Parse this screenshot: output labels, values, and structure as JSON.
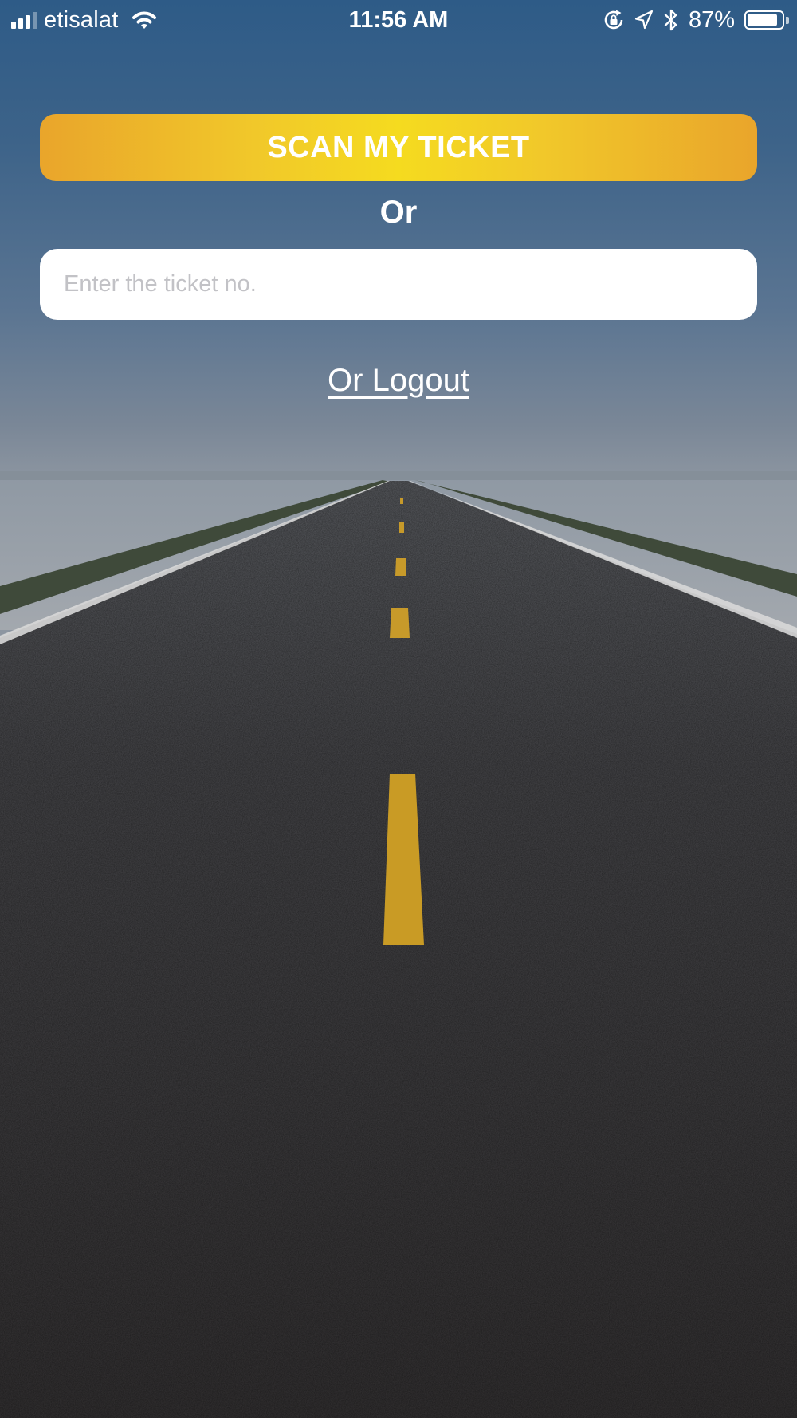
{
  "status_bar": {
    "carrier": "etisalat",
    "time": "11:56 AM",
    "battery_percent_label": "87%",
    "battery_level": 0.87,
    "signal_bars_active": 3,
    "signal_bars_total": 4,
    "icons": [
      "signal-icon",
      "wifi-icon",
      "rotation-lock-icon",
      "location-arrow-icon",
      "bluetooth-icon",
      "battery-icon"
    ]
  },
  "scan": {
    "label": "SCAN MY TICKET"
  },
  "divider": {
    "or_label": "Or"
  },
  "ticket_input": {
    "value": "",
    "placeholder": "Enter the ticket no."
  },
  "logout": {
    "label": "Or Logout"
  },
  "colors": {
    "scan_button_edge": "#e9a52b",
    "scan_button_center": "#f5db1f",
    "text": "#ffffff",
    "input_bg": "#ffffff",
    "placeholder": "#c2c2c6"
  }
}
